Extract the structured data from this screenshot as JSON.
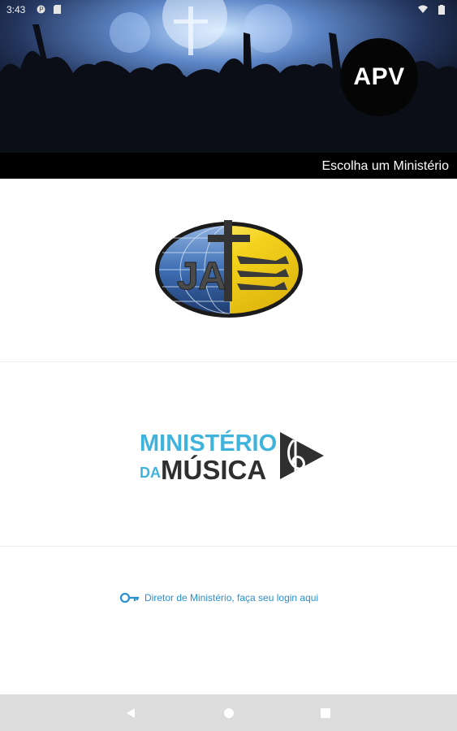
{
  "status_bar": {
    "time": "3:43"
  },
  "header": {
    "badge": "APV",
    "title": "Escolha um Ministério"
  },
  "ministries": [
    {
      "name": "JAT",
      "logo_letters": "JAT"
    },
    {
      "name": "Ministério da Música",
      "logo_line1": "MINISTÉRIO",
      "logo_line2_small": "DA",
      "logo_line2_big": "MÚSICA"
    }
  ],
  "login": {
    "label": "Diretor de Ministério, faça seu login aqui"
  },
  "colors": {
    "accent": "#2a8fd0",
    "mm_blue": "#3fb3dc",
    "mm_dark": "#2f2f2f",
    "jat_yellow": "#f3d21c",
    "jat_blue": "#3e6fb5"
  },
  "icons": [
    "wifi-icon",
    "battery-icon",
    "key-icon",
    "back-icon",
    "home-icon",
    "recents-icon"
  ]
}
